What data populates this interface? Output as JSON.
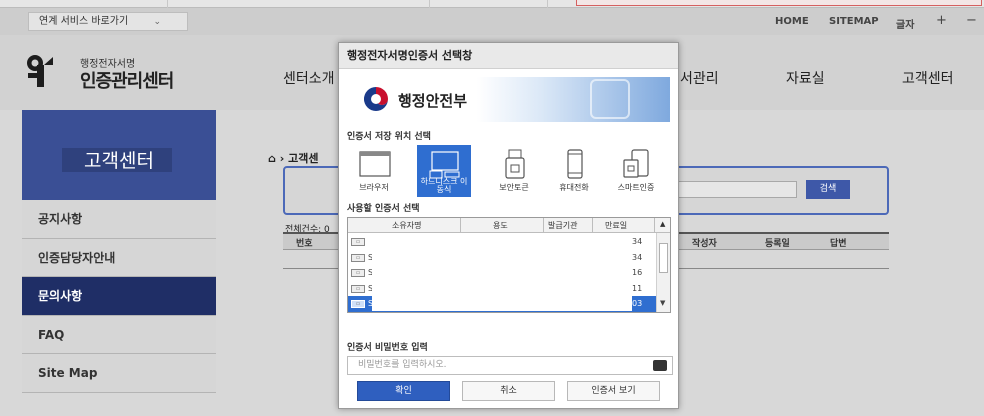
{
  "top_bar": {
    "service_select": "연계 서비스 바로가기",
    "util_links": [
      "HOME",
      "SITEMAP",
      "글자",
      "+",
      "−"
    ]
  },
  "header": {
    "logo_sub": "행정전자서명",
    "logo_main": "인증관리센터",
    "nav": [
      "센터소개",
      "서관리",
      "자료실",
      "고객센터"
    ]
  },
  "sidebar": {
    "title": "고객센터",
    "items": [
      {
        "label": "공지사항"
      },
      {
        "label": "인증담당자안내"
      },
      {
        "label": "문의사항"
      },
      {
        "label": "FAQ"
      },
      {
        "label": "Site Map"
      }
    ]
  },
  "main": {
    "breadcrumb": "고객센",
    "search_button": "검색",
    "total_label": "전체건수: 0",
    "columns": [
      "번호",
      "작성자",
      "등록일",
      "답변"
    ]
  },
  "dialog": {
    "title": "행정전자서명인증서 선택창",
    "ministry": "행정안전부",
    "location_section": "인증서 저장 위치 선택",
    "locations": [
      {
        "label": "브라우저"
      },
      {
        "label": "하드디스크 이동식"
      },
      {
        "label": "보안토큰"
      },
      {
        "label": "휴대전화"
      },
      {
        "label": "스마트인증"
      }
    ],
    "cert_section": "사용할 인증서 선택",
    "cert_columns": [
      "소유자명",
      "용도",
      "발급기관",
      "만료일"
    ],
    "certs": [
      {
        "name": "",
        "expiry": "34"
      },
      {
        "name": "S",
        "expiry": "34"
      },
      {
        "name": "S",
        "expiry": "16"
      },
      {
        "name": "S",
        "expiry": "11"
      },
      {
        "name": "S",
        "expiry": "03"
      }
    ],
    "password_section": "인증서 비밀번호 입력",
    "password_placeholder": "비밀번호를 입력하시오.",
    "buttons": {
      "confirm": "확인",
      "cancel": "취소",
      "view": "인증서 보기"
    }
  }
}
